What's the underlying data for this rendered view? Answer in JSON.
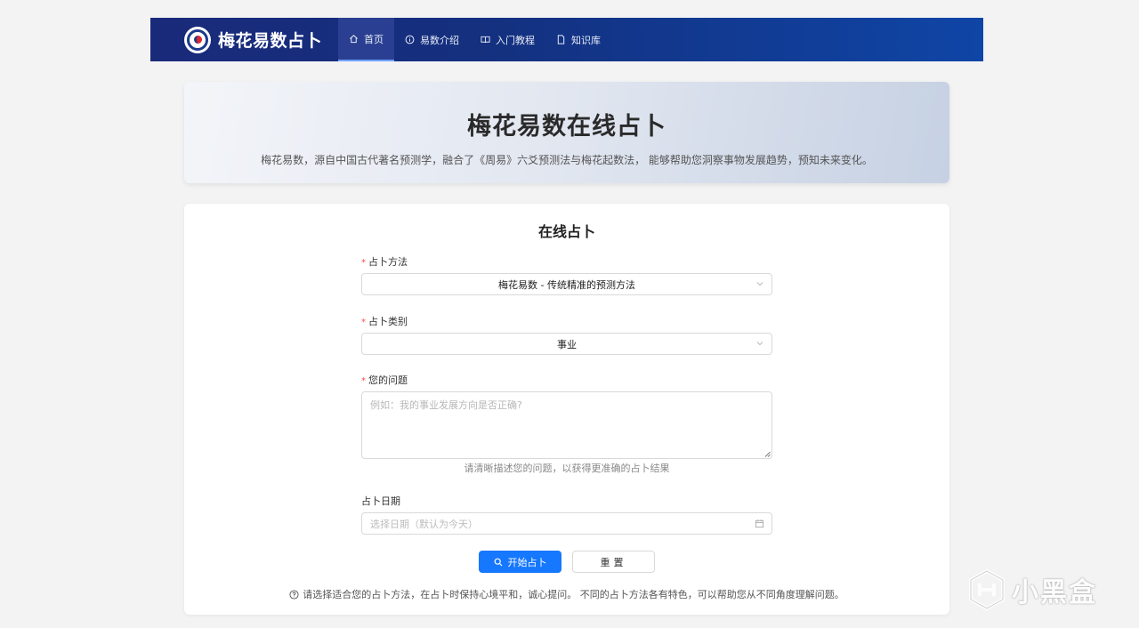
{
  "brand": {
    "name": "梅花易数占卜"
  },
  "nav": {
    "items": [
      {
        "label": "首页",
        "icon": "home-icon",
        "active": true
      },
      {
        "label": "易数介绍",
        "icon": "info-icon",
        "active": false
      },
      {
        "label": "入门教程",
        "icon": "book-icon",
        "active": false
      },
      {
        "label": "知识库",
        "icon": "file-icon",
        "active": false
      }
    ]
  },
  "hero": {
    "title": "梅花易数在线占卜",
    "description": "梅花易数，源自中国古代著名预测学，融合了《周易》六爻预测法与梅花起数法， 能够帮助您洞察事物发展趋势，预知未来变化。"
  },
  "form": {
    "title": "在线占卜",
    "method": {
      "label": "占卜方法",
      "value": "梅花易数 - 传统精准的预测方法"
    },
    "category": {
      "label": "占卜类别",
      "value": "事业"
    },
    "question": {
      "label": "您的问题",
      "placeholder": "例如：我的事业发展方向是否正确?",
      "helper": "请清晰描述您的问题，以获得更准确的占卜结果"
    },
    "date": {
      "label": "占卜日期",
      "placeholder": "选择日期（默认为今天）"
    },
    "submit_label": "开始占卜",
    "reset_label": "重置",
    "tip": "请选择适合您的占卜方法，在占卜时保持心境平和，诚心提问。 不同的占卜方法各有特色，可以帮助您从不同角度理解问题。"
  },
  "watermark": {
    "text": "小黑盒"
  },
  "colors": {
    "primary": "#1677ff",
    "nav_start": "#1a2a7a",
    "nav_end": "#0f45a6",
    "required": "#ff4d4f"
  }
}
